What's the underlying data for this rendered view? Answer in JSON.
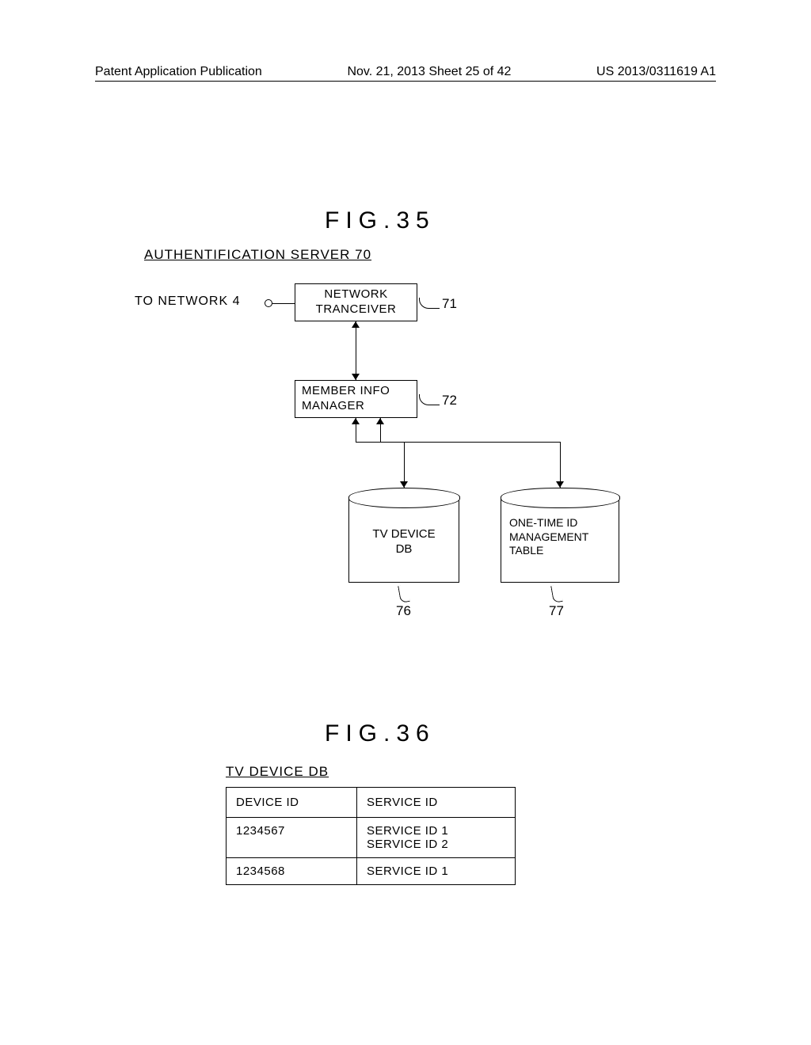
{
  "header": {
    "left": "Patent Application Publication",
    "center": "Nov. 21, 2013  Sheet 25 of 42",
    "right": "US 2013/0311619 A1"
  },
  "fig35": {
    "title": "FIG.35",
    "subtitle": "AUTHENTIFICATION SERVER 70",
    "to_network": "TO NETWORK 4",
    "network_tranceiver": "NETWORK\nTRANCEIVER",
    "member_info_manager": "MEMBER INFO\nMANAGER",
    "tv_device_db": "TV DEVICE\nDB",
    "one_time_table": "ONE-TIME ID\nMANAGEMENT\nTABLE",
    "ref": {
      "r71": "71",
      "r72": "72",
      "r76": "76",
      "r77": "77"
    }
  },
  "fig36": {
    "title": "FIG.36",
    "subtitle": "TV DEVICE DB",
    "table": {
      "headers": {
        "c1": "DEVICE ID",
        "c2": "SERVICE ID"
      },
      "rows": [
        {
          "c1": "1234567",
          "c2": "SERVICE ID 1\nSERVICE ID 2"
        },
        {
          "c1": "1234568",
          "c2": "SERVICE ID 1"
        }
      ]
    }
  }
}
